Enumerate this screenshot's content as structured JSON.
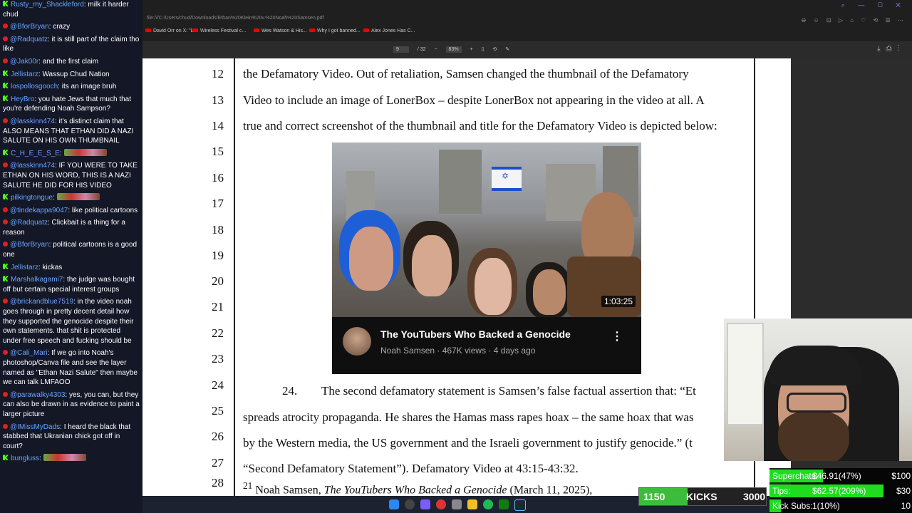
{
  "chat": [
    {
      "platform": "kick",
      "user": "Rusty_my_Shackleford",
      "text": "milk it harder chud"
    },
    {
      "platform": "yt",
      "user": "@BforBryan",
      "text": "crazy"
    },
    {
      "platform": "yt",
      "user": "@Radquatz",
      "text": "it is still part of the claim tho like"
    },
    {
      "platform": "yt",
      "user": "@Jak00r",
      "text": "and the first claim"
    },
    {
      "platform": "kick",
      "user": "Jellistarz",
      "text": "Wassup Chud Nation"
    },
    {
      "platform": "kick",
      "user": "lospollosgooch",
      "text": "its an image bruh"
    },
    {
      "platform": "kick",
      "user": "HeyBro",
      "text": "you hate Jews that much that you're defending Noah Sampson?"
    },
    {
      "platform": "yt",
      "user": "@lasskinn474",
      "text": "it's distinct claim that ALSO MEANS THAT ETHAN DID A NAZI SALUTE ON HIS OWN THUMBNAIL"
    },
    {
      "platform": "kick",
      "user": "C_H_E_E_S_E",
      "text": ""
    },
    {
      "platform": "yt",
      "user": "@lasskinn474",
      "text": "IF YOU WERE TO TAKE ETHAN ON HIS WORD, THIS IS A NAZI SALUTE HE DID FOR HIS VIDEO"
    },
    {
      "platform": "kick",
      "user": "pilkingtongue",
      "text": ""
    },
    {
      "platform": "yt",
      "user": "@tindekappa9047",
      "text": "like political cartoons"
    },
    {
      "platform": "yt",
      "user": "@Radquatz",
      "text": "Clickbait is a thing for a reason"
    },
    {
      "platform": "yt",
      "user": "@BforBryan",
      "text": "political cartoons is a good one"
    },
    {
      "platform": "kick",
      "user": "Jellistarz",
      "text": "kickas"
    },
    {
      "platform": "kick",
      "user": "Marshalkagami7",
      "text": "the judge was bought off but certain special interest groups"
    },
    {
      "platform": "yt",
      "user": "@brickandblue7519",
      "text": "in the video noah goes through in pretty decent detail how they supported the genocide despite their own statements. that shit is protected under free speech and fucking should be"
    },
    {
      "platform": "yt",
      "user": "@Cali_Mari",
      "text": "If we go into Noah's photoshop/Canva file and see the layer named as \"Ethan Nazi Salute\" then maybe we can talk LMFAOO"
    },
    {
      "platform": "yt",
      "user": "@parawalky4303",
      "text": "yes, you can, but they can also be drawn in as evidence to paint a larger picture"
    },
    {
      "platform": "yt",
      "user": "@IMissMyDads",
      "text": "I heard the black that stabbed that Ukranian chick got off in court?"
    },
    {
      "platform": "kick",
      "user": "bungluss",
      "text": ""
    }
  ],
  "browser": {
    "address": "file:///C:/Users/chud/Downloads/Ethan%20Klein%20v.%20Noah%20Samsen.pdf",
    "tab_title": "Ethan Klein v. Noah Samsen.pdf",
    "bookmarks": [
      "David Orr on X: \"L...",
      "Wireless Festival c...",
      "Wes Watson & His...",
      "Why I got banned...",
      "Alex Jones Has C..."
    ]
  },
  "pdf_toolbar": {
    "page_current": "9",
    "page_total": "/ 32",
    "zoom": "83%",
    "minus": "−",
    "plus": "+"
  },
  "document": {
    "line_numbers": [
      "12",
      "13",
      "14",
      "15",
      "16",
      "17",
      "18",
      "19",
      "20",
      "21",
      "22",
      "23",
      "24",
      "25",
      "26",
      "27",
      "28"
    ],
    "lines": [
      "the Defamatory Video. Out of retaliation, Samsen changed the thumbnail of the Defamatory",
      "Video to include an image of LonerBox – despite LonerBox not appearing in the video at all. A",
      "true and correct screenshot of the thumbnail and title for the Defamatory Video is depicted below:"
    ],
    "para24_num": "24.",
    "para24_lines": [
      "The second defamatory statement is Samsen’s false factual assertion that: “Et",
      "spreads atrocity propaganda. He shares the Hamas mass rapes hoax – the same hoax that was",
      "by the Western media, the US government and the Israeli government to justify genocide.” (t",
      "“Second Defamatory Statement”). Defamatory Video at 43:15-43:32."
    ],
    "footnote_num": "21",
    "footnote_text": "Noah Samsen, ",
    "footnote_italic": "The YouTubers Who Backed a Genocide",
    "footnote_tail": " (March 11, 2025),"
  },
  "video_card": {
    "duration": "1:03:25",
    "title": "The YouTubers Who Backed a Genocide",
    "meta": "Noah Samsen · 467K views · 4 days ago",
    "menu": "⋮"
  },
  "kicks": {
    "left": "1150",
    "label": "KICKS",
    "right": "3000",
    "progress": 0.38
  },
  "stats": [
    {
      "label": "Superchats:",
      "value": "$46.91(47%)",
      "goal": "$100",
      "progress": 0.47
    },
    {
      "label": "Tips:",
      "value": "$62.57(209%)",
      "goal": "$30",
      "progress": 1.0
    },
    {
      "label": "Kick Subs:",
      "value": "1(10%)",
      "goal": "10",
      "progress": 0.1
    }
  ],
  "colors": {
    "kick_green": "#53fc18",
    "yt_red": "#e02020",
    "username": "#6aa4ff"
  }
}
